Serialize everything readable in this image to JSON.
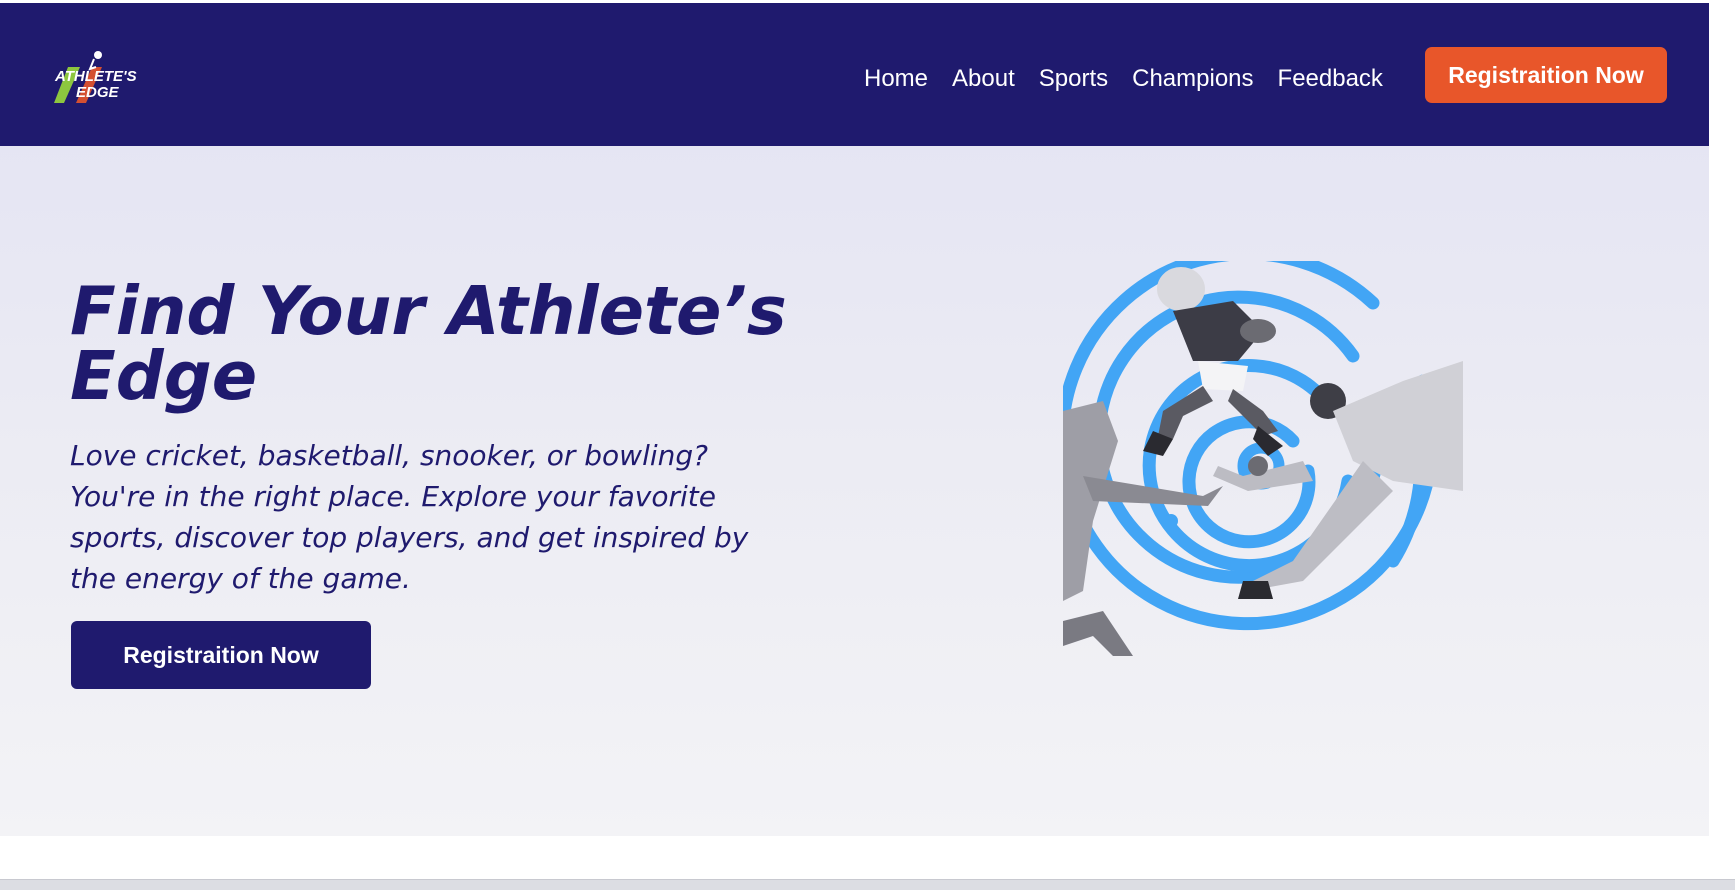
{
  "header": {
    "logo_text": "ATHLETE'S EDGE",
    "nav": [
      {
        "label": "Home"
      },
      {
        "label": "About"
      },
      {
        "label": "Sports"
      },
      {
        "label": "Champions"
      },
      {
        "label": "Feedback"
      }
    ],
    "cta_label": "Registraition Now"
  },
  "hero": {
    "title": "Find Your Athlete’s Edge",
    "subtitle": "Love cricket, basketball, snooker, or bowling? You're in the right place. Explore your favorite sports, discover top players, and get inspired by the energy of the game.",
    "cta_label": "Registraition Now"
  },
  "colors": {
    "brand_navy": "#1f1a6e",
    "accent_orange": "#e8562a",
    "ring_blue": "#42a5f5"
  }
}
